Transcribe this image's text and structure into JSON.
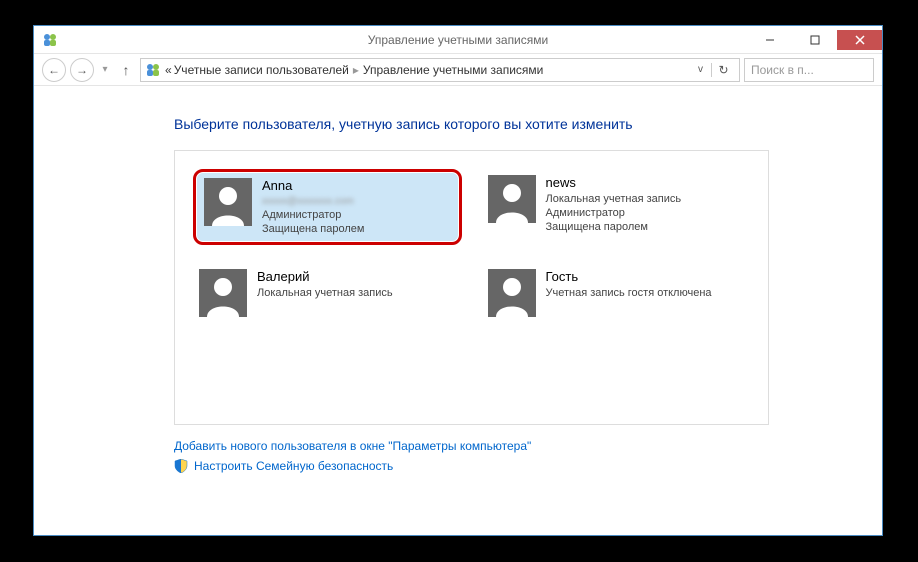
{
  "window": {
    "title": "Управление учетными записями"
  },
  "breadcrumb": {
    "prefix": "«",
    "item1": "Учетные записи пользователей",
    "item2": "Управление учетными записями"
  },
  "search": {
    "placeholder": "Поиск в п..."
  },
  "heading": "Выберите пользователя, учетную запись которого вы хотите изменить",
  "users": [
    {
      "name": "Anna",
      "email": "xxxxx@xxxxxxx.com",
      "line1": "Администратор",
      "line2": "Защищена паролем",
      "selected": true
    },
    {
      "name": "news",
      "line1": "Локальная учетная запись",
      "line2": "Администратор",
      "line3": "Защищена паролем"
    },
    {
      "name": "Валерий",
      "line1": "Локальная учетная запись"
    },
    {
      "name": "Гость",
      "line1": "Учетная запись гостя отключена"
    }
  ],
  "links": {
    "add_user": "Добавить нового пользователя в окне \"Параметры компьютера\"",
    "family_safety": "Настроить Семейную безопасность"
  }
}
